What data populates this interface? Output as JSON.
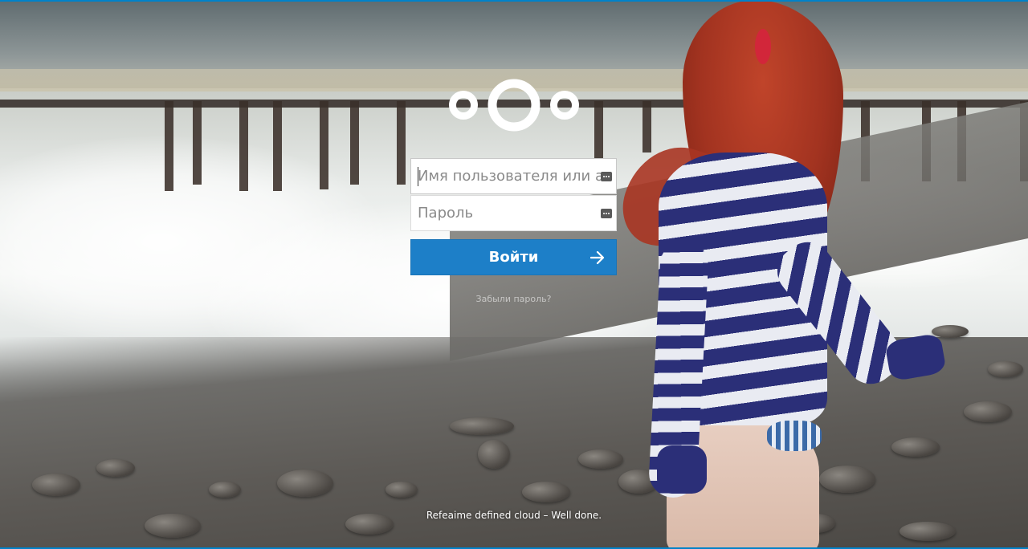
{
  "colors": {
    "accent": "#0082c9",
    "button_bg": "#1d7fc8",
    "button_text": "#ffffff"
  },
  "logo": {
    "icon": "nextcloud-logo-icon"
  },
  "login": {
    "username_placeholder": "Имя пользователя или адрес эл. почты",
    "password_placeholder": "Пароль",
    "submit_label": "Войти",
    "submit_icon": "arrow-right-icon",
    "field_icon": "password-manager-icon"
  },
  "forgot_password": {
    "label": "Забыли пароль?"
  },
  "footer": {
    "text": "Refeaime defined cloud – Well done."
  }
}
